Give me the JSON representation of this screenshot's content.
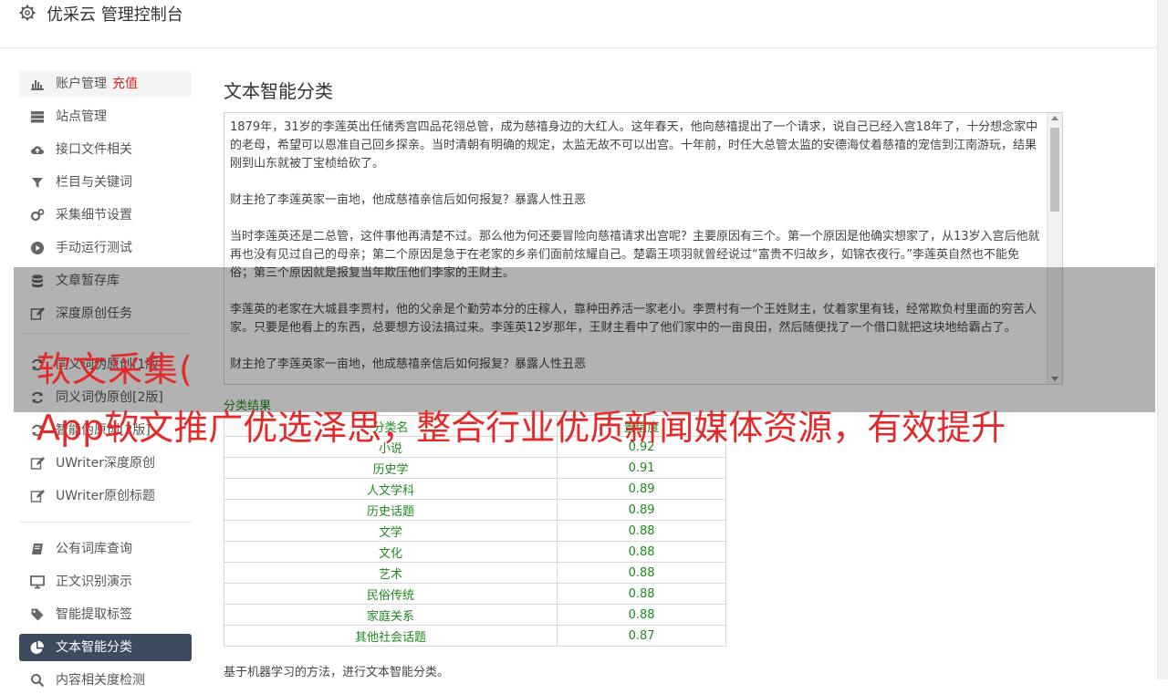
{
  "header": {
    "title": "优采云 管理控制台"
  },
  "sidebar": {
    "items": [
      {
        "label": "账户管理",
        "extra": "充值",
        "icon": "bar-chart-icon"
      },
      {
        "label": "站点管理",
        "icon": "server-icon"
      },
      {
        "label": "接口文件相关",
        "icon": "cloud-upload-icon"
      },
      {
        "label": "栏目与关键词",
        "icon": "filter-icon"
      },
      {
        "label": "采集细节设置",
        "icon": "gears-icon"
      },
      {
        "label": "手动运行测试",
        "icon": "play-circle-icon"
      },
      {
        "label": "文章暂存库",
        "icon": "database-icon"
      },
      {
        "label": "深度原创任务",
        "icon": "edit-icon"
      },
      {
        "label": "同义词伪原创[1版]",
        "icon": "refresh-icon"
      },
      {
        "label": "同义词伪原创[2版]",
        "icon": "refresh-icon"
      },
      {
        "label": "智能伪原创[2版]",
        "icon": "refresh-icon"
      },
      {
        "label": "UWriter深度原创",
        "icon": "edit-icon"
      },
      {
        "label": "UWriter原创标题",
        "icon": "edit-icon"
      },
      {
        "label": "公有词库查询",
        "icon": "book-icon"
      },
      {
        "label": "正文识别演示",
        "icon": "monitor-icon"
      },
      {
        "label": "智能提取标签",
        "icon": "tag-icon"
      },
      {
        "label": "文本智能分类",
        "icon": "pie-chart-icon"
      },
      {
        "label": "内容相关度检测",
        "icon": "search-icon"
      }
    ]
  },
  "main": {
    "title": "文本智能分类",
    "text_paragraphs": [
      "1879年，31岁的李莲英出任储秀宫四品花翎总管，成为慈禧身边的大红人。这年春天，他向慈禧提出了一个请求，说自己已经入宫18年了，十分想念家中的老母，希望可以恩准自己回乡探亲。当时清朝有明确的规定，太监无故不可以出宫。十年前，时任大总管太监的安德海仗着慈禧的宠信到江南游玩，结果刚到山东就被丁宝桢给砍了。",
      "财主抢了李莲英家一亩地，他成慈禧亲信后如何报复？暴露人性丑恶",
      "当时李莲英还是二总管，这件事他再清楚不过。那么他为何还要冒险向慈禧请求出宫呢？主要原因有三个。第一个原因是他确实想家了，从13岁入宫后他就再也没有见过自己的母亲；第二个原因是急于在老家的乡亲们面前炫耀自己。楚霸王项羽就曾经说过“富贵不归故乡，如锦衣夜行。”李莲英自然也不能免俗；第三个原因就是报复当年欺压他们李家的王财主。",
      "李莲英的老家在大城县李贾村，他的父亲是个勤劳本分的庄稼人，靠种田养活一家老小。李贾村有一个王姓财主，仗着家里有钱，经常欺负村里面的穷苦人家。只要是他看上的东西，总要想方设法搞过来。李莲英12岁那年，王财主看中了他们家中的一亩良田，然后随便找了一个借口就把这块地给霸占了。",
      "财主抢了李莲英家一亩地，他成慈禧亲信后如何报复？暴露人性丑恶"
    ],
    "result_label": "分类结果",
    "table_headers": [
      "分类名",
      "置信度"
    ],
    "table_rows": [
      [
        "小说",
        "0.92"
      ],
      [
        "历史学",
        "0.91"
      ],
      [
        "人文学科",
        "0.89"
      ],
      [
        "历史话题",
        "0.89"
      ],
      [
        "文学",
        "0.88"
      ],
      [
        "文化",
        "0.88"
      ],
      [
        "艺术",
        "0.88"
      ],
      [
        "民俗传统",
        "0.88"
      ],
      [
        "家庭关系",
        "0.88"
      ],
      [
        "其他社会话题",
        "0.87"
      ]
    ],
    "note": "基于机器学习的方法，进行文本智能分类。"
  },
  "overlay": {
    "line1": "软文采集(",
    "line2": "App软文推广优选泽思，整合行业优质新闻媒体资源，有效提升"
  },
  "colors": {
    "active_bg": "#3c4b5d",
    "result_green": "#1e8a1e",
    "overlay_text": "#e32a2a",
    "recharge_red": "#d9261c"
  }
}
